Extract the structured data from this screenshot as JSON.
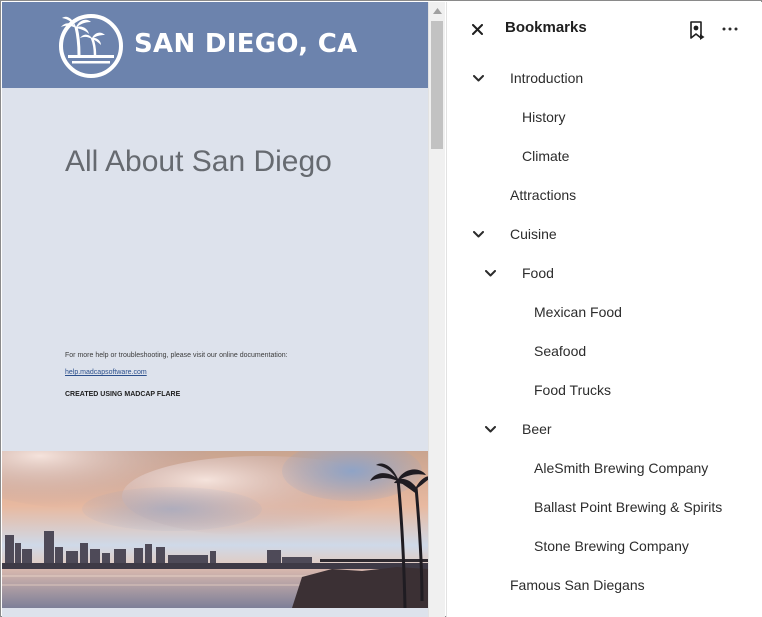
{
  "document": {
    "logo_text": "SAN DIEGO, CA",
    "title": "All About San Diego",
    "help_text": "For more help or troubleshooting, please visit our online documentation:",
    "help_link": "help.madcapsoftware.com",
    "created_text": "CREATED USING MADCAP FLARE",
    "colors": {
      "header": "#6c83ad",
      "page": "#dde2ec",
      "title": "#666a70",
      "link": "#2b4f8c"
    }
  },
  "bookmarks": {
    "title": "Bookmarks",
    "icons": {
      "close": "close-icon",
      "add": "add-bookmark-icon",
      "more": "more-options-icon",
      "expanded": "chevron-down-icon"
    },
    "items": [
      {
        "label": "Introduction",
        "level": 0,
        "expanded": true
      },
      {
        "label": "History",
        "level": 1,
        "expanded": null
      },
      {
        "label": "Climate",
        "level": 1,
        "expanded": null
      },
      {
        "label": "Attractions",
        "level": 0,
        "expanded": null
      },
      {
        "label": "Cuisine",
        "level": 0,
        "expanded": true
      },
      {
        "label": "Food",
        "level": 1,
        "expanded": true
      },
      {
        "label": "Mexican Food",
        "level": 2,
        "expanded": null
      },
      {
        "label": "Seafood",
        "level": 2,
        "expanded": null
      },
      {
        "label": "Food Trucks",
        "level": 2,
        "expanded": null
      },
      {
        "label": "Beer",
        "level": 1,
        "expanded": true
      },
      {
        "label": "AleSmith Brewing Company",
        "level": 2,
        "expanded": null
      },
      {
        "label": "Ballast Point Brewing & Spirits",
        "level": 2,
        "expanded": null
      },
      {
        "label": "Stone Brewing Company",
        "level": 2,
        "expanded": null
      },
      {
        "label": "Famous San Diegans",
        "level": 0,
        "expanded": null
      }
    ]
  }
}
